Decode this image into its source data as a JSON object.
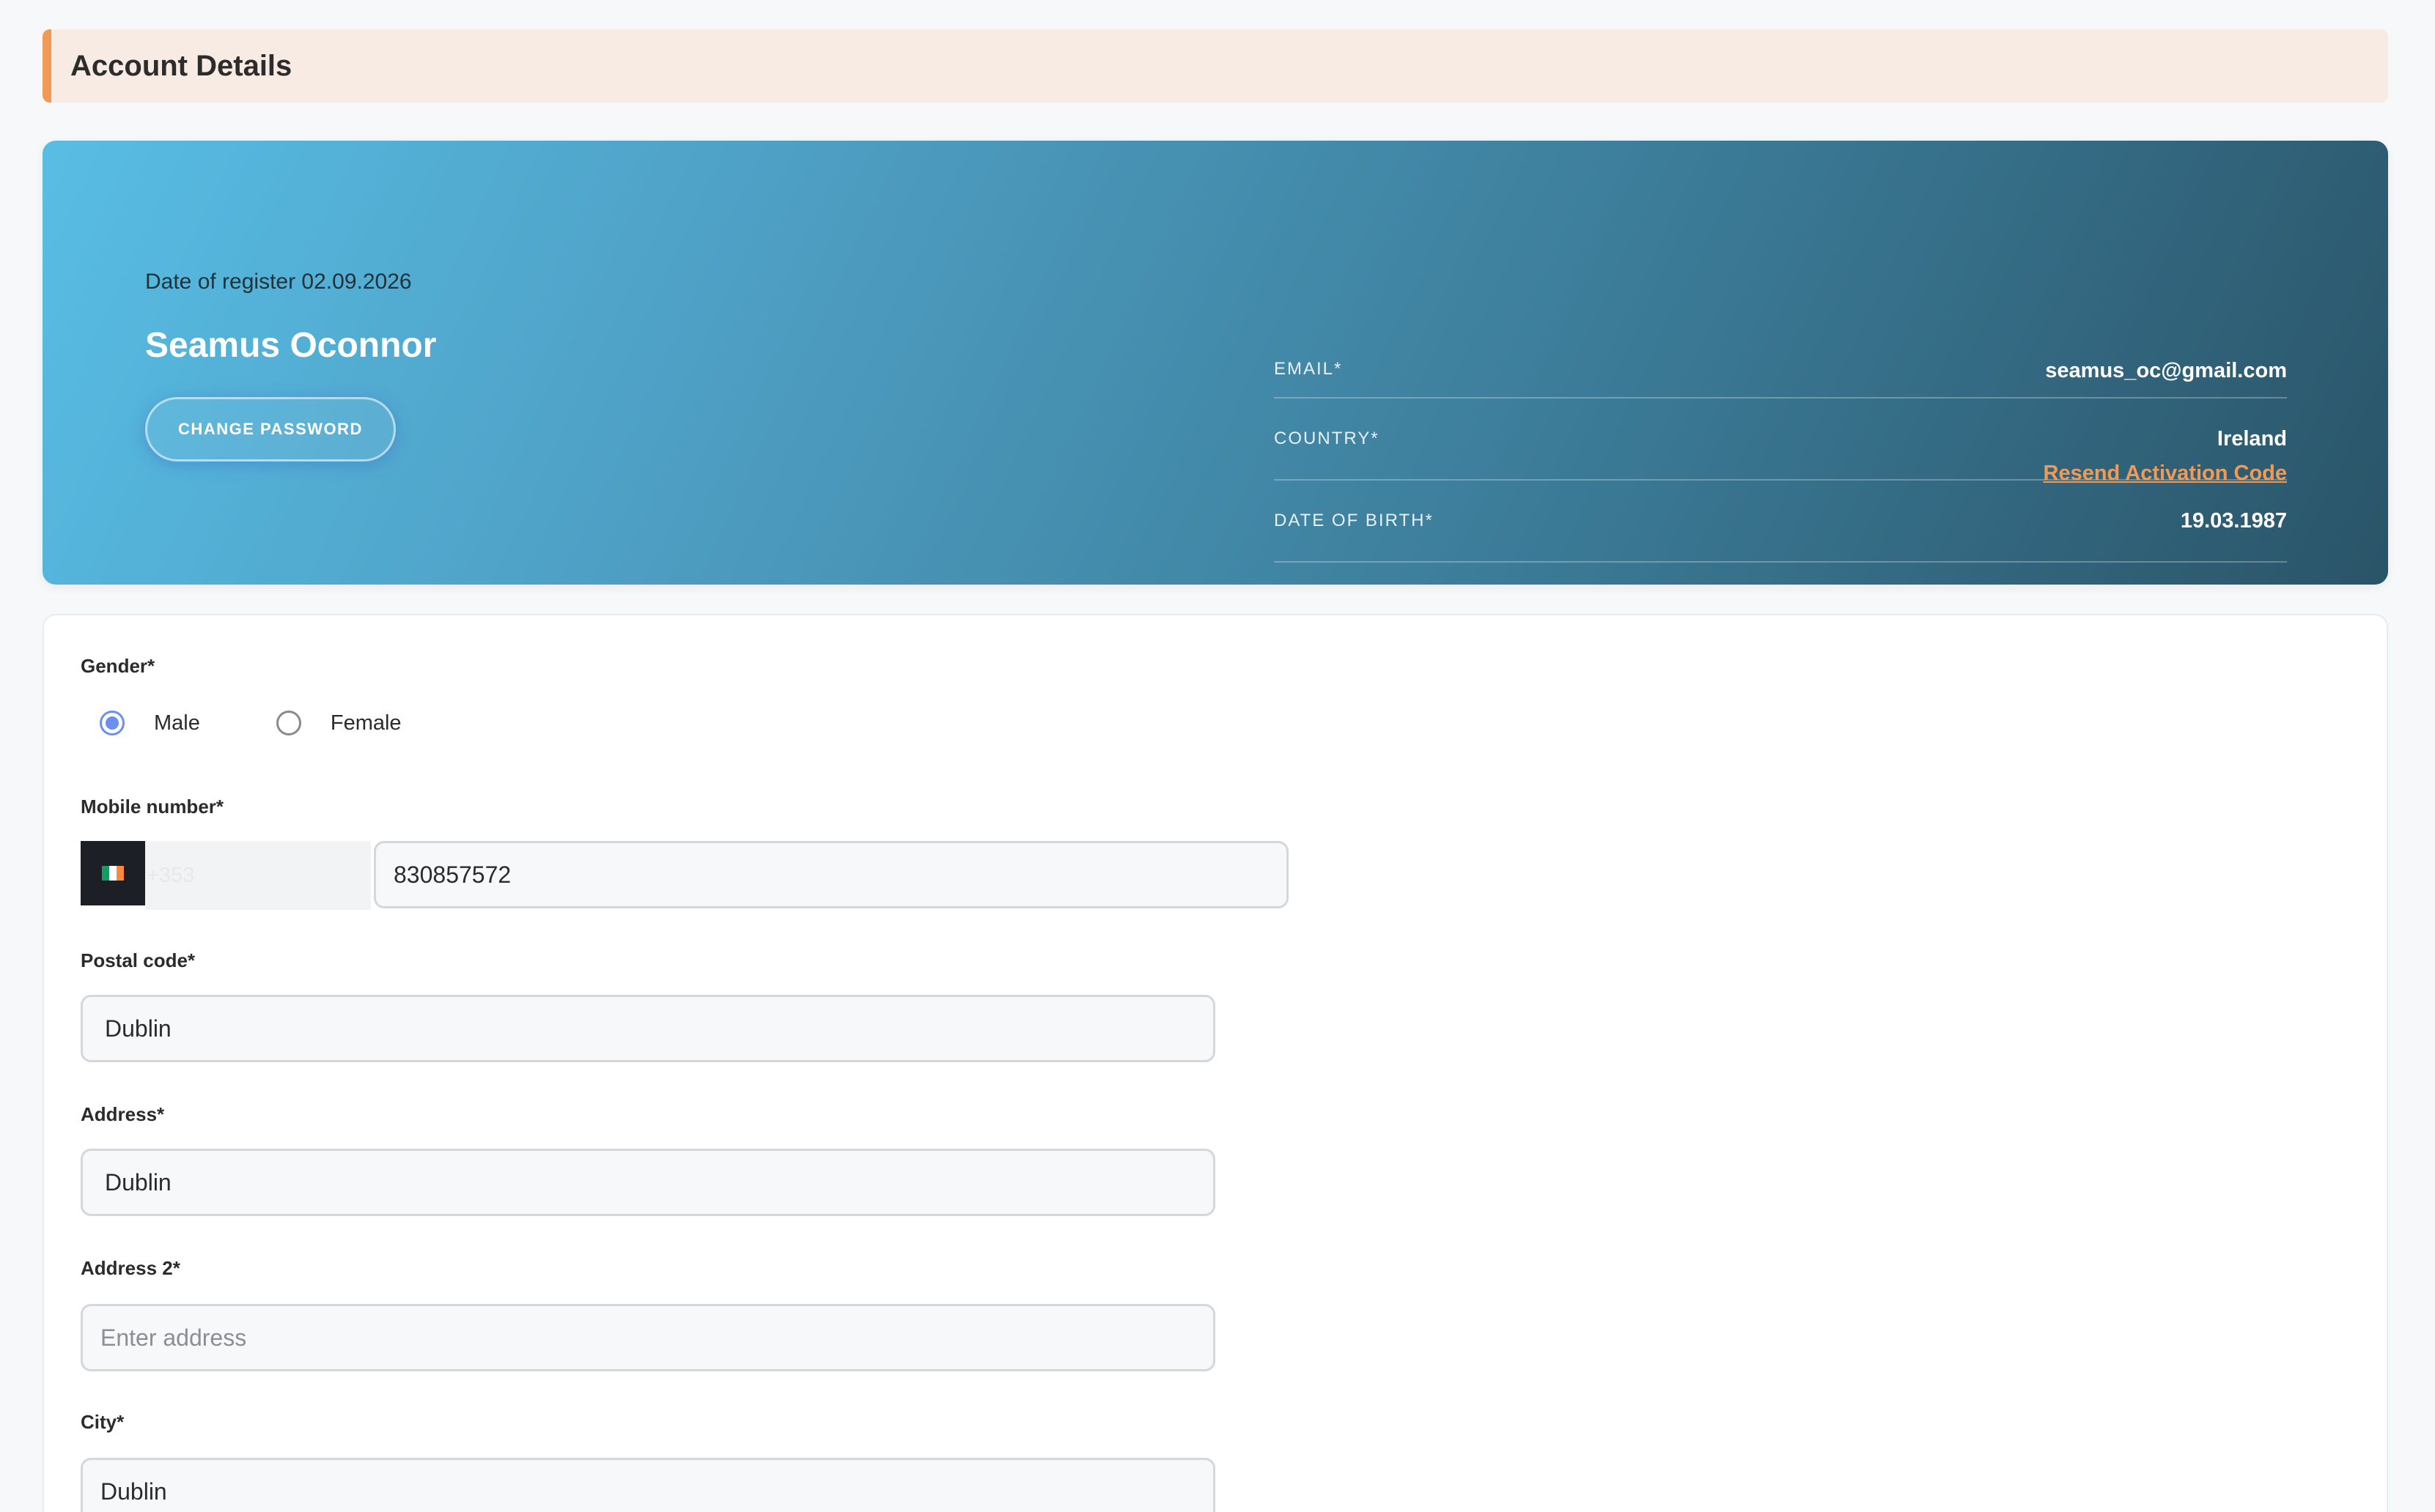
{
  "page": {
    "title": "Account Details"
  },
  "profile": {
    "register_date": "Date of register 02.09.2026",
    "name": "Seamus Oconnor",
    "change_password_label": "CHANGE PASSWORD",
    "info": [
      {
        "label": "EMAIL*",
        "value": "seamus_oc@gmail.com"
      },
      {
        "label": "COUNTRY*",
        "value": "Ireland"
      },
      {
        "label": "DATE OF BIRTH*",
        "value": "19.03.1987"
      }
    ],
    "resend_label": "Resend Activation Code"
  },
  "form": {
    "gender": {
      "label": "Gender*",
      "options": [
        "Male",
        "Female"
      ],
      "selected": "Male"
    },
    "mobile": {
      "label": "Mobile number*",
      "dial_code": "+353",
      "number": "830857572",
      "flag_icon": "ireland-flag-icon"
    },
    "postal_code": {
      "label": "Postal code*",
      "value": "Dublin"
    },
    "address": {
      "label": "Address*",
      "value": "Dublin"
    },
    "address2": {
      "label": "Address 2*",
      "placeholder": "Enter address"
    },
    "city": {
      "label": "City*",
      "value": "Dublin"
    }
  },
  "colors": {
    "accent": "#f29a55",
    "radio_selected": "#6a8ff0",
    "card_gradient_start": "#58bde4",
    "card_gradient_end": "#2a5468"
  }
}
